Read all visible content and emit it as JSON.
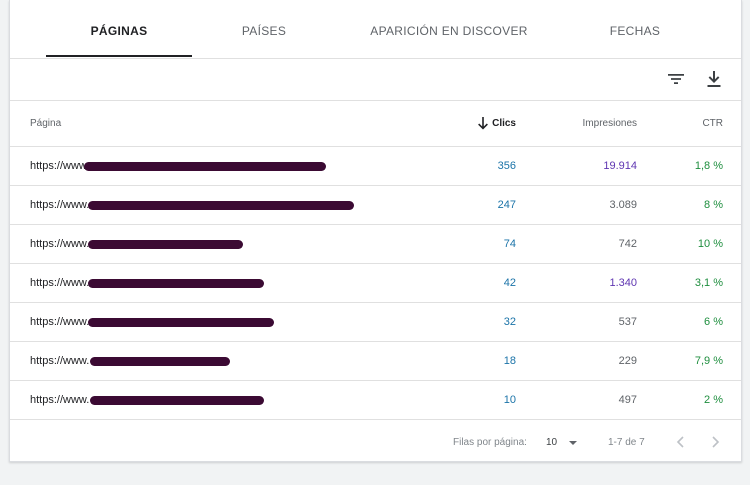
{
  "tabs": [
    {
      "label": "PÁGINAS",
      "active": true
    },
    {
      "label": "PAÍSES",
      "active": false
    },
    {
      "label": "APARICIÓN EN DISCOVER",
      "active": false
    },
    {
      "label": "FECHAS",
      "active": false
    }
  ],
  "toolbar": {
    "filter_icon": "filter-icon",
    "download_icon": "download-icon"
  },
  "table": {
    "headers": {
      "page": "Página",
      "clicks": "Clics",
      "impressions": "Impresiones",
      "ctr": "CTR"
    },
    "sort_icon": "arrow-down-icon",
    "rows": [
      {
        "url": "https://www.",
        "clicks": "356",
        "impressions": "19.914",
        "ctr": "1,8 %"
      },
      {
        "url": "https://www.",
        "clicks": "247",
        "impressions": "3.089",
        "ctr": "8 %"
      },
      {
        "url": "https://www.",
        "clicks": "74",
        "impressions": "742",
        "ctr": "10 %"
      },
      {
        "url": "https://www.",
        "clicks": "42",
        "impressions": "1.340",
        "ctr": "3,1 %"
      },
      {
        "url": "https://www.",
        "clicks": "32",
        "impressions": "537",
        "ctr": "6 %"
      },
      {
        "url": "https://www.",
        "clicks": "18",
        "impressions": "229",
        "ctr": "7,9 %"
      },
      {
        "url": "https://www.",
        "clicks": "10",
        "impressions": "497",
        "ctr": "2 %"
      }
    ]
  },
  "footer": {
    "rows_per_page_label": "Filas por página:",
    "rows_per_page_value": "10",
    "range": "1-7 de 7"
  },
  "colors": {
    "clicks": "#1a73a8",
    "impressions": "#5e35b1",
    "ctr": "#1e8e3e",
    "redaction": "#3b0a33"
  }
}
